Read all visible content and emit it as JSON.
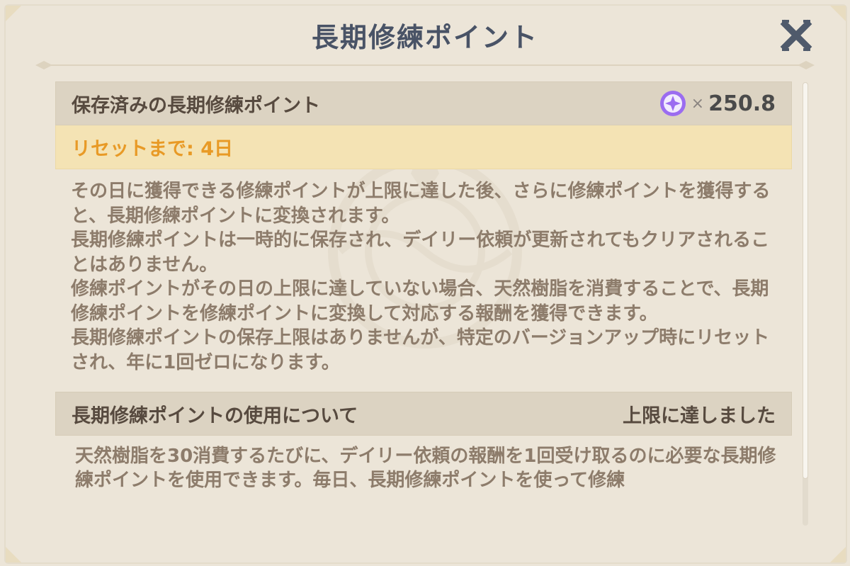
{
  "dialog": {
    "title": "長期修練ポイント",
    "close_icon": "close-icon"
  },
  "stored": {
    "label": "保存済みの長期修練ポイント",
    "icon": "star-point-icon",
    "times": "×",
    "value": "250.8",
    "reset": "リセットまで: 4日"
  },
  "description": {
    "paragraphs": [
      "その日に獲得できる修練ポイントが上限に達した後、さらに修練ポイントを獲得すると、長期修練ポイントに変換されます。",
      "長期修練ポイントは一時的に保存され、デイリー依頼が更新されてもクリアされることはありません。",
      "修練ポイントがその日の上限に達していない場合、天然樹脂を消費することで、長期修練ポイントを修練ポイントに変換して対応する報酬を獲得できます。",
      "長期修練ポイントの保存上限はありませんが、特定のバージョンアップ時にリセットされ、年に1回ゼロになります。"
    ]
  },
  "usage": {
    "label": "長期修練ポイントの使用について",
    "status": "上限に達しました",
    "text": "天然樹脂を30消費するたびに、デイリー依頼の報酬を1回受け取るのに必要な長期修練ポイントを使用できます。毎日、長期修練ポイントを使って修練"
  },
  "colors": {
    "background": "#ece5d8",
    "header": "#dcd3c2",
    "reset_bar": "#f4e3b4",
    "reset_text": "#e89a26",
    "body_text": "#8d7c6b",
    "title_text": "#495366",
    "point_icon": "#9b6cf0"
  }
}
